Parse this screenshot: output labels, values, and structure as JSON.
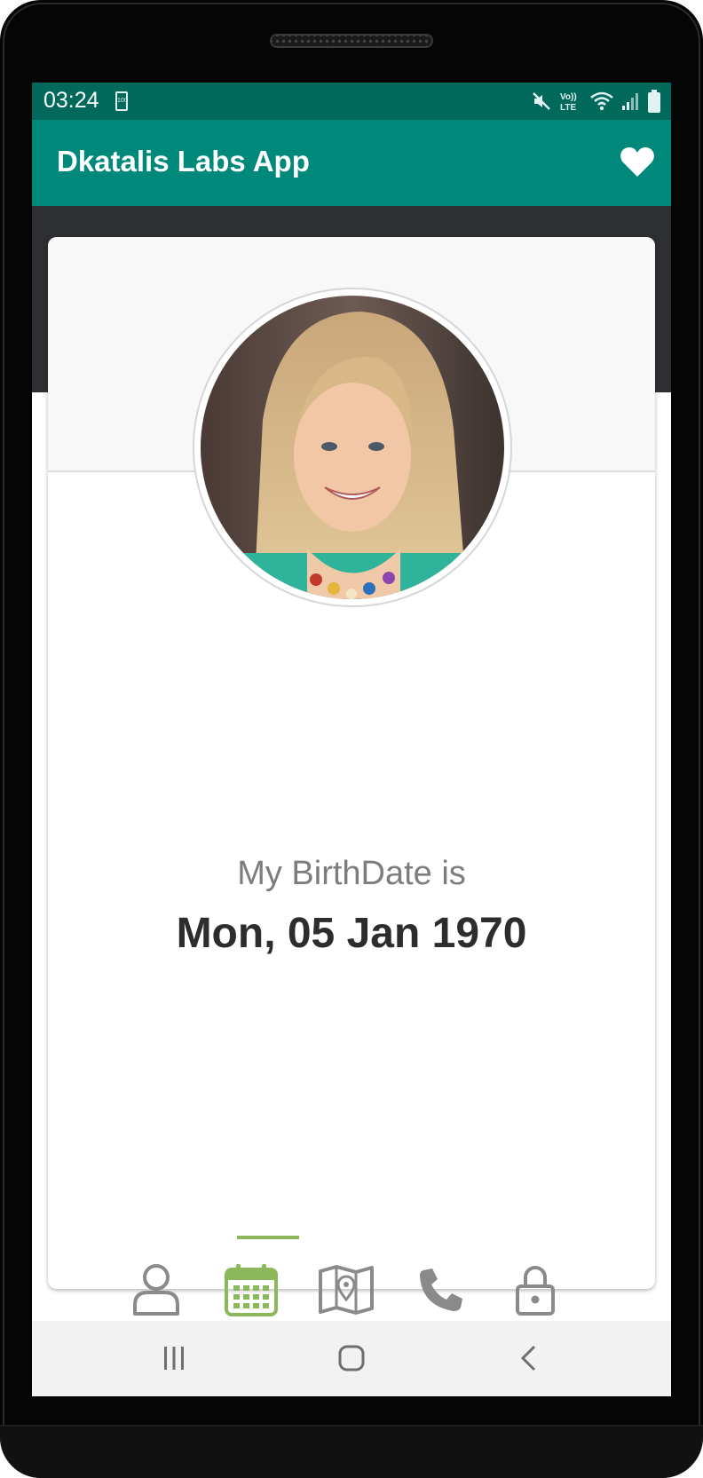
{
  "status_bar": {
    "time": "03:24",
    "battery_label": "100",
    "icons": [
      "mute-icon",
      "volte-icon",
      "wifi-icon",
      "signal-icon",
      "battery-icon"
    ],
    "volte_label": "Vo)) LTE"
  },
  "app_bar": {
    "title": "Dkatalis Labs App",
    "action_icon": "heart-icon"
  },
  "profile": {
    "label": "My BirthDate is",
    "value": "Mon, 05 Jan 1970"
  },
  "tabs": [
    {
      "icon": "user-icon",
      "active": false
    },
    {
      "icon": "calendar-icon",
      "active": true
    },
    {
      "icon": "map-icon",
      "active": false
    },
    {
      "icon": "phone-icon",
      "active": false
    },
    {
      "icon": "lock-icon",
      "active": false
    }
  ],
  "nav_bar": {
    "icons": [
      "recent-apps-icon",
      "home-icon",
      "back-icon"
    ]
  },
  "colors": {
    "status_bar": "#00695c",
    "app_bar": "#00897b",
    "accent_active": "#8bb85a",
    "icon_inactive": "#8a8a8a",
    "header_band": "#2e2f33"
  }
}
